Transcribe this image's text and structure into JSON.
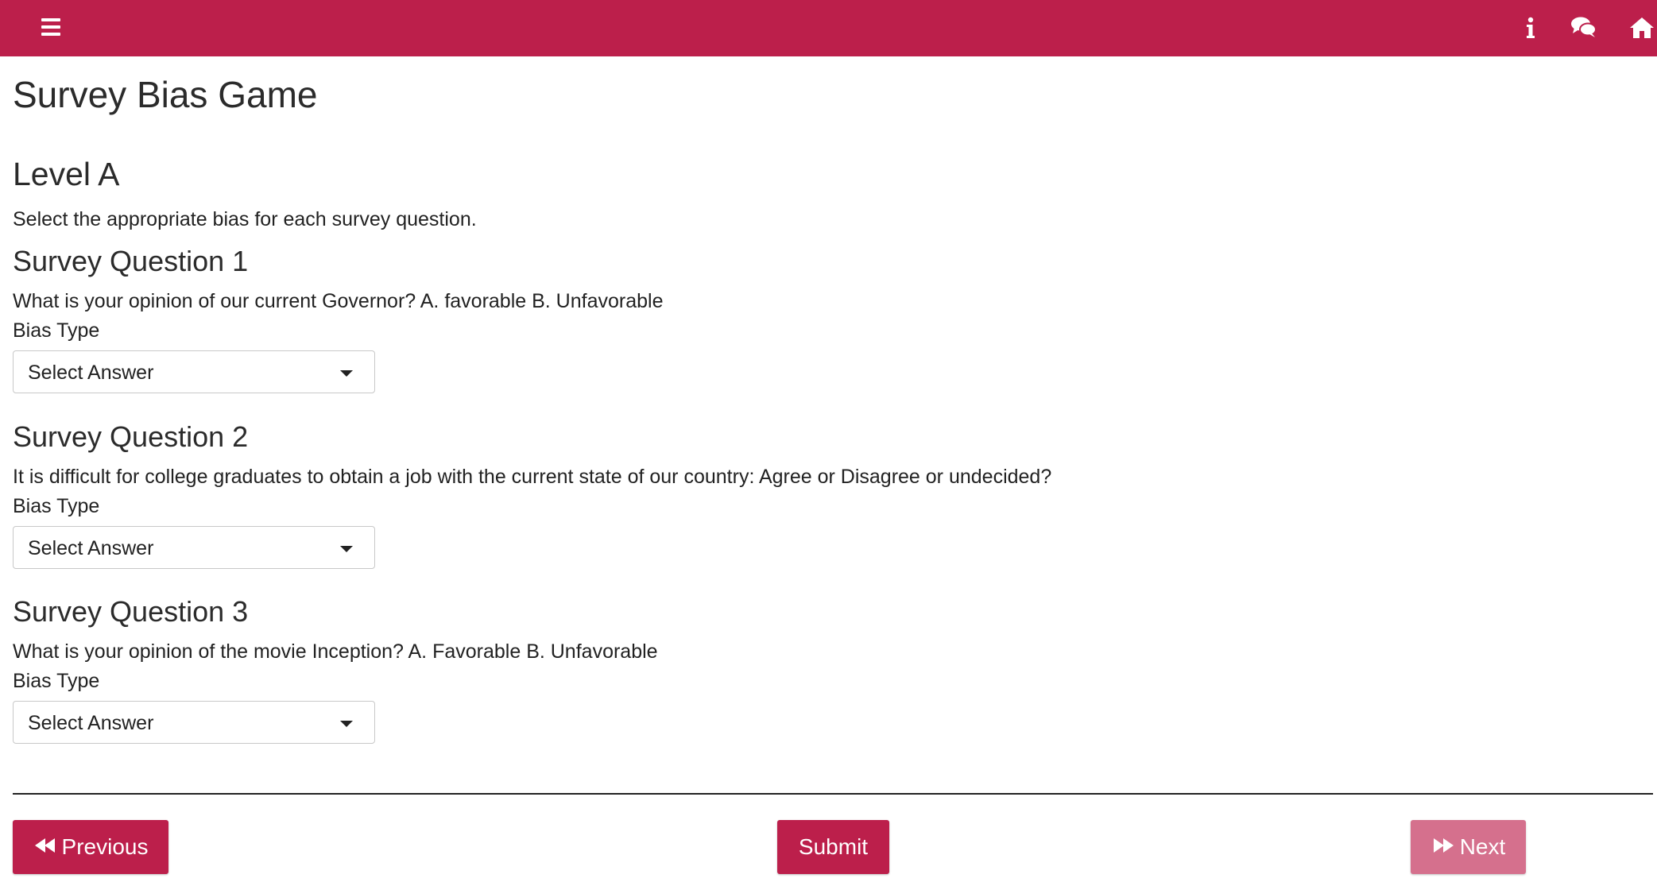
{
  "topbar": {
    "background": "#BC1F4B",
    "menu_icon": "hamburger-menu-icon",
    "right_icons": [
      "info-icon",
      "chat-icon",
      "home-icon"
    ],
    "info_glyph": "i"
  },
  "page": {
    "title": "Survey Bias Game",
    "level_title": "Level A",
    "instructions": "Select the appropriate bias for each survey question."
  },
  "questions": [
    {
      "heading": "Survey Question 1",
      "text": "What is your opinion of our current Governor? A. favorable B. Unfavorable",
      "field_label": "Bias Type",
      "selected_value": "Select Answer"
    },
    {
      "heading": "Survey Question 2",
      "text": "It is difficult for college graduates to obtain a job with the current state of our country: Agree or Disagree or undecided?",
      "field_label": "Bias Type",
      "selected_value": "Select Answer"
    },
    {
      "heading": "Survey Question 3",
      "text": "What is your opinion of the movie Inception? A. Favorable B. Unfavorable",
      "field_label": "Bias Type",
      "selected_value": "Select Answer"
    }
  ],
  "footer": {
    "previous_label": "Previous",
    "previous_icon": "fast-backward-icon",
    "submit_label": "Submit",
    "next_label": "Next",
    "next_icon": "fast-forward-icon",
    "next_disabled_color": "#D5708D",
    "accent": "#BC1F4B"
  }
}
